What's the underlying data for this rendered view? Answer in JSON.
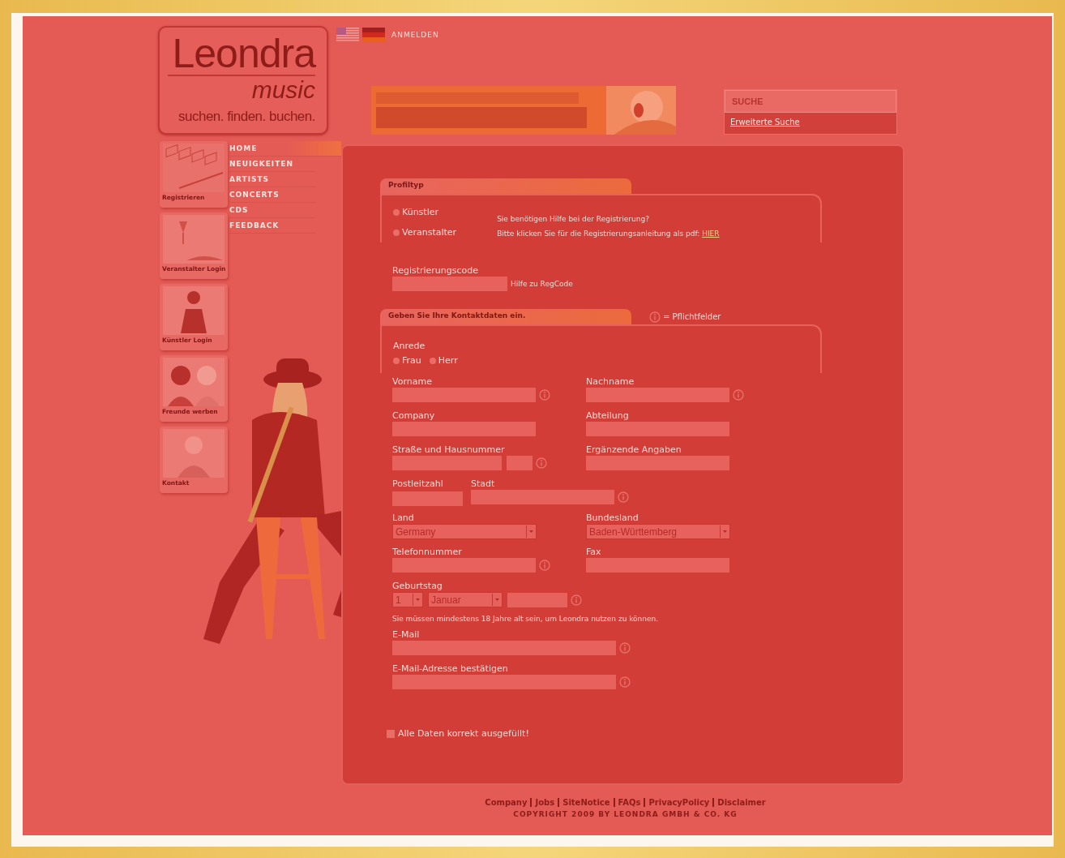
{
  "header": {
    "login_link": "ANMELDEN"
  },
  "logo": {
    "title": "Leondra",
    "subtitle": "music",
    "tagline": "suchen. finden. buchen."
  },
  "search": {
    "placeholder": "SUCHE",
    "advanced_link": "Erweiterte Suche"
  },
  "side_tiles": [
    {
      "label": "Registrieren"
    },
    {
      "label": "Veranstalter Login"
    },
    {
      "label": "Künstler Login"
    },
    {
      "label": "Freunde werben"
    },
    {
      "label": "Kontakt"
    }
  ],
  "nav": [
    {
      "label": "HOME",
      "selected": true
    },
    {
      "label": "NEUIGKEITEN",
      "selected": false
    },
    {
      "label": "ARTISTS",
      "selected": false
    },
    {
      "label": "CONCERTS",
      "selected": false
    },
    {
      "label": "CDS",
      "selected": false
    },
    {
      "label": "FEEDBACK",
      "selected": false
    }
  ],
  "profile_section": {
    "title": "Profiltyp",
    "options": [
      {
        "label": "Künstler",
        "selected": false
      },
      {
        "label": "Veranstalter",
        "selected": false
      }
    ],
    "help_question": "Sie benötigen Hilfe bei der Registrierung?",
    "help_text": "Bitte klicken Sie für die Registrierungsanleitung als pdf:",
    "help_link": "HIER",
    "code_label": "Registrierungscode",
    "code_help": "Hilfe zu RegCode"
  },
  "contact_section": {
    "title": "Geben Sie Ihre Kontaktdaten ein.",
    "required_note": "= Pflichtfelder",
    "salutation_label": "Anrede",
    "salutations": [
      {
        "label": "Frau",
        "selected": false
      },
      {
        "label": "Herr",
        "selected": false
      }
    ],
    "rows": [
      [
        {
          "kind": "text",
          "label": "Vorname",
          "required": true
        },
        {
          "kind": "text",
          "label": "Nachname",
          "required": true
        }
      ],
      [
        {
          "kind": "text",
          "label": "Company",
          "required": false
        },
        {
          "kind": "text",
          "label": "Abteilung",
          "required": false
        }
      ],
      [
        {
          "kind": "street",
          "label": "Straße und Hausnummer",
          "required": true
        },
        {
          "kind": "text",
          "label": "Ergänzende Angaben",
          "required": false
        }
      ],
      [
        {
          "kind": "zip_city",
          "labels": [
            "Postleitzahl",
            "Stadt"
          ],
          "required": true
        }
      ],
      [
        {
          "kind": "select",
          "label": "Land",
          "value": "Germany",
          "required": false
        },
        {
          "kind": "select",
          "label": "Bundesland",
          "value": "Baden-Württemberg",
          "required": false
        }
      ],
      [
        {
          "kind": "text",
          "label": "Telefonnummer",
          "required": true
        },
        {
          "kind": "text",
          "label": "Fax",
          "required": false
        }
      ],
      [
        {
          "kind": "birthday",
          "label": "Geburtstag",
          "values": [
            "1",
            "Januar"
          ],
          "required": true
        }
      ],
      [
        {
          "kind": "note",
          "text": "Sie müssen mindestens 18 Jahre alt sein, um Leondra nutzen zu können."
        }
      ],
      [
        {
          "kind": "wide",
          "label": "E-Mail",
          "required": true
        }
      ],
      [
        {
          "kind": "wide",
          "label": "E-Mail-Adresse bestätigen",
          "required": true
        }
      ]
    ],
    "confirm": {
      "label": "Alle Daten korrekt ausgefüllt!",
      "checked": false
    }
  },
  "footer": {
    "links": [
      "Company",
      "Jobs",
      "SiteNotice",
      "FAQs",
      "PrivacyPolicy",
      "Disclaimer"
    ],
    "copyright": "COPYRIGHT 2009 BY LEONDRA GMBH & CO. KG"
  }
}
